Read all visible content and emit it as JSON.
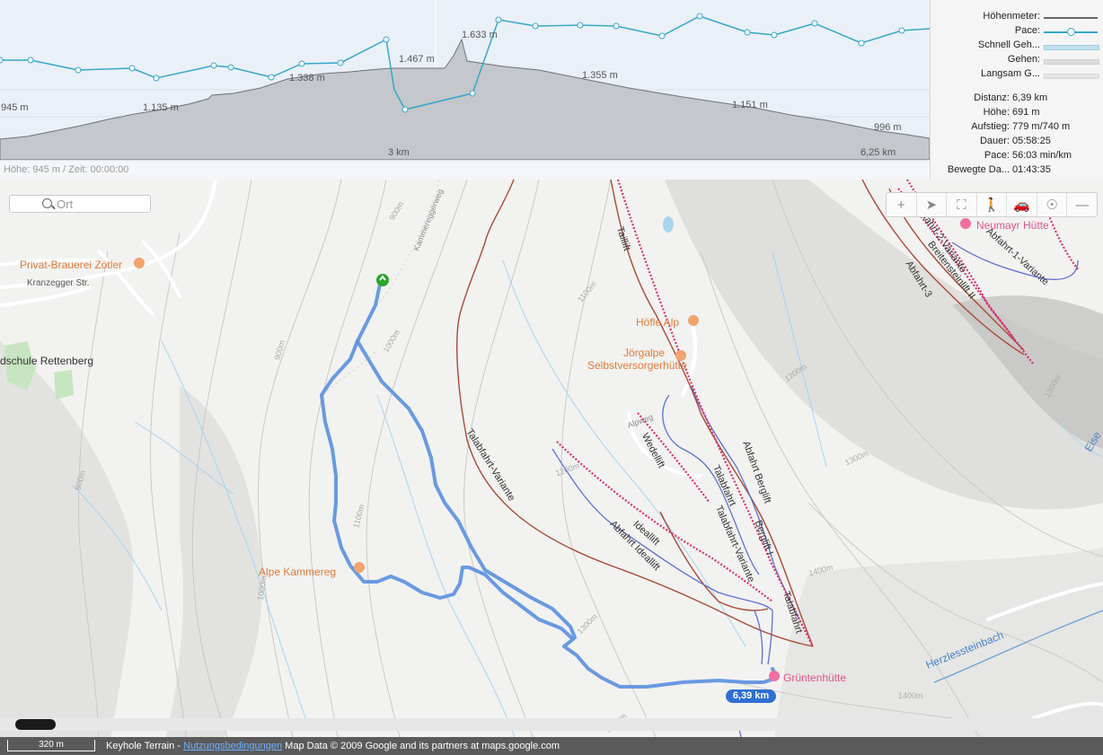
{
  "profile": {
    "peak_labels": [
      "945 m",
      "1.135 m",
      "1.338 m",
      "1.467 m",
      "1.633 m",
      "1.355 m",
      "1.151 m",
      "996 m"
    ],
    "km_labels": [
      "3 km",
      "6,25 km"
    ],
    "status": "Höhe: 945 m / Zeit: 00:00:00"
  },
  "legend": [
    {
      "label": "Höhenmeter:",
      "color": "#666666"
    },
    {
      "label": "Pace:",
      "color": "#36a7c9"
    },
    {
      "label": "Schnell Geh...",
      "color": "#bfe1ec"
    },
    {
      "label": "Gehen:",
      "color": "#dcdcdc"
    },
    {
      "label": "Langsam G...",
      "color": "#e6e6e6"
    }
  ],
  "stats": [
    {
      "label": "Distanz:",
      "value": "6,39 km"
    },
    {
      "label": "Höhe:",
      "value": "691 m"
    },
    {
      "label": "Aufstieg:",
      "value": "779 m/740 m"
    },
    {
      "label": "Dauer:",
      "value": "05:58:25"
    },
    {
      "label": "Pace:",
      "value": "56:03 min/km"
    },
    {
      "label": "Bewegte Da...",
      "value": "01:43:35"
    }
  ],
  "map": {
    "search_placeholder": "Ort",
    "places": {
      "brauerei": "Privat-Brauerei Zötler",
      "schule": "dschule Rettenberg",
      "kranzegger": "Kranzegger Str.",
      "alpe": "Alpe Kammereg",
      "hoefle": "Höfle Alp",
      "joergalpe1": "Jörgalpe",
      "joergalpe2": "Selbstversorgerhütte",
      "neumayr": "Neumayr Hütte",
      "gruenten": "Grüntenhütte",
      "herzless": "Herzlessteinbach"
    },
    "runs": {
      "talabfahrt_variante": "Talabfahrt-Variante",
      "wedellift": "Wedellift",
      "idealift": "Ideallift",
      "abfahrt_ideallift": "Abfahrt Ideallift",
      "abfahrt_berglift": "Abfahrt Berglift",
      "talabfahrt": "Talabfahrt",
      "talabfahrt_variante2": "Talabfahrt-Variante",
      "berglift": "Berglift I",
      "talabfahrt2": "Talabfahrt",
      "abfahrt2": "Abfahrt-2-Variante",
      "breitensteinlift": "Breitensteinlift II",
      "abfahrt3": "Abfahrt-3",
      "abfahrt1": "Abfahrt-1-Variante",
      "taillift": "Taillift",
      "kammweg": "Kammereggerweg",
      "alpweg": "Alpweg"
    },
    "contours": [
      "900m",
      "1000m",
      "1100m",
      "1200m",
      "1300m",
      "1400m",
      "800m",
      "1000m",
      "900m",
      "1300m",
      "1400m",
      "1100m",
      "1200m",
      "1300m",
      "1400m"
    ],
    "distance_badge": "6,39 km",
    "eisen": "Eise"
  },
  "bottom": {
    "scale": "320 m",
    "prefix": "Keyhole Terrain - ",
    "terms_link": "Nutzungsbedingungen",
    "suffix": " Map Data © 2009 Google and its partners at maps.google.com"
  }
}
